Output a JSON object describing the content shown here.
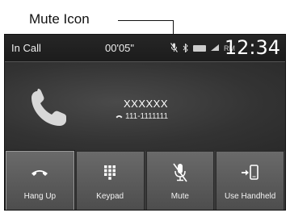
{
  "callout": {
    "label": "Mute Icon"
  },
  "status_bar": {
    "left_text": "In Call",
    "timer": "00'05\"",
    "icons": [
      "mute-icon",
      "bluetooth-icon",
      "battery-icon",
      "signal-icon"
    ],
    "roaming_text": "RM",
    "clock": "12:34"
  },
  "call": {
    "caller_name": "XXXXXX",
    "caller_number": "111-1111111"
  },
  "buttons": [
    {
      "label": "Hang Up",
      "icon": "hang-up-icon"
    },
    {
      "label": "Keypad",
      "icon": "keypad-icon"
    },
    {
      "label": "Mute",
      "icon": "mute-icon"
    },
    {
      "label": "Use Handheld",
      "icon": "handheld-icon"
    }
  ]
}
